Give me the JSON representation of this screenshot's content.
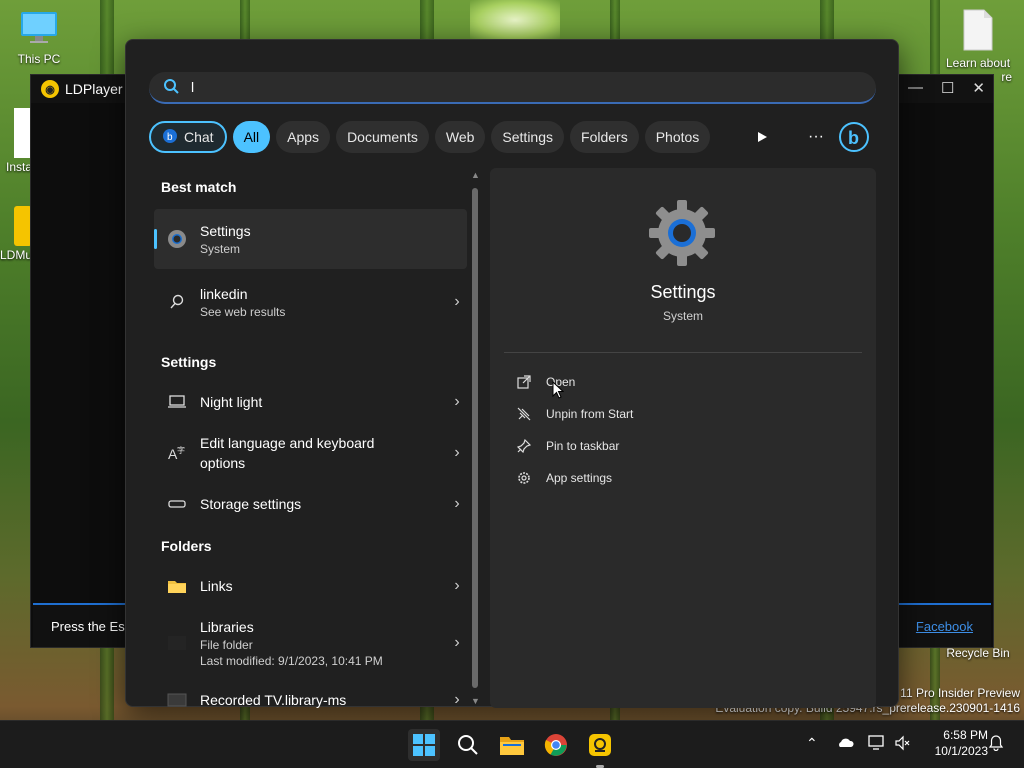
{
  "desktop": {
    "icons": [
      {
        "label": "This PC"
      },
      {
        "label": "Insta"
      },
      {
        "label": "LDMu"
      },
      {
        "label": "Learn about"
      },
      {
        "label": "re"
      },
      {
        "label": "Recycle Bin"
      }
    ],
    "watermark_line1": "s 11 Pro Insider Preview",
    "watermark_line2": "Evaluation copy. Build 25947.rs_prerelease.230901-1416"
  },
  "ldplayer": {
    "title": "LDPlayer",
    "bottom_text": "Press the Esc",
    "link": "Facebook"
  },
  "search": {
    "query": "l",
    "chips": [
      "Chat",
      "All",
      "Apps",
      "Documents",
      "Web",
      "Settings",
      "Folders",
      "Photos"
    ],
    "active_chip": "All"
  },
  "results": {
    "best_match_header": "Best match",
    "best_match": {
      "title": "Settings",
      "subtitle": "System"
    },
    "web": {
      "title": "linkedin",
      "subtitle": "See web results"
    },
    "settings_header": "Settings",
    "settings_items": [
      {
        "title": "Night light"
      },
      {
        "title": "Edit language and keyboard",
        "title2": "options"
      },
      {
        "title": "Storage settings"
      }
    ],
    "folders_header": "Folders",
    "folder_items": [
      {
        "title": "Links"
      },
      {
        "title": "Libraries",
        "subtitle": "File folder",
        "detail": "Last modified: 9/1/2023, 10:41 PM"
      },
      {
        "title": "Recorded TV.library-ms"
      }
    ]
  },
  "preview": {
    "title": "Settings",
    "subtitle": "System",
    "actions": [
      "Open",
      "Unpin from Start",
      "Pin to taskbar",
      "App settings"
    ]
  },
  "taskbar": {
    "time": "6:58 PM",
    "date": "10/1/2023"
  },
  "colors": {
    "accent": "#4cc2ff",
    "panel": "#202020",
    "pane": "#2a2a2a"
  }
}
